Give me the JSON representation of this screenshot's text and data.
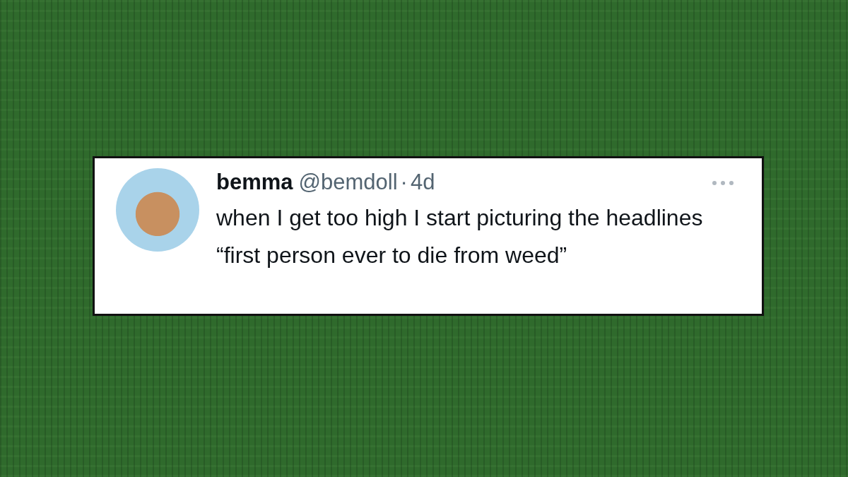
{
  "tweet": {
    "display_name": "bemma",
    "handle": "@bemdoll",
    "separator": "·",
    "time": "4d",
    "text": "when I get too high I start picturing the headlines “first person ever to die from weed”"
  }
}
